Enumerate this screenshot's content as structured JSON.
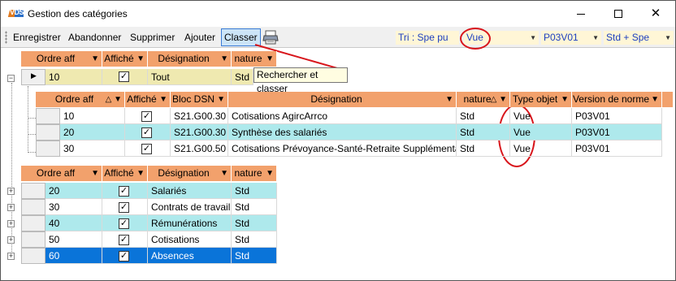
{
  "window": {
    "title": "Gestion des catégories",
    "app_icon": "vds-logo",
    "app_icon_text": "VDS",
    "minimize_icon": "minimize-icon",
    "maximize_icon": "maximize-icon",
    "close_icon": "close-icon",
    "close_glyph": "✕"
  },
  "toolbar": {
    "enregistrer": "Enregistrer",
    "abandonner": "Abandonner",
    "supprimer": "Supprimer",
    "ajouter": "Ajouter",
    "classer": "Classer",
    "print_icon": "printer-icon",
    "tri": "Tri : Spe pu",
    "vue": "Vue",
    "version": "P03V01",
    "std": "Std + Spe"
  },
  "tooltip": "Rechercher et classer",
  "top_grid": {
    "headers": [
      "Ordre aff",
      "Affiché",
      "Désignation",
      "nature"
    ],
    "row": {
      "ordre": "10",
      "affiche": true,
      "designation": "Tout",
      "nature": "Std"
    }
  },
  "child_grid": {
    "headers": [
      "Ordre aff",
      "Affiché",
      "Bloc DSN",
      "Désignation",
      "nature",
      "Type objet",
      "Version de norme"
    ],
    "rows": [
      {
        "ordre": "10",
        "affiche": true,
        "bloc": "S21.G00.30",
        "designation": "Cotisations AgircArrco",
        "nature": "Std",
        "type": "Vue",
        "version": "P03V01"
      },
      {
        "ordre": "20",
        "affiche": true,
        "bloc": "S21.G00.30",
        "designation": "Synthèse des salariés",
        "nature": "Std",
        "type": "Vue",
        "version": "P03V01"
      },
      {
        "ordre": "30",
        "affiche": true,
        "bloc": "S21.G00.50",
        "designation": "Cotisations Prévoyance-Santé-Retraite Supplémentaire",
        "nature": "Std",
        "type": "Vue",
        "version": "P03V01"
      }
    ]
  },
  "bottom_grid": {
    "headers": [
      "Ordre aff",
      "Affiché",
      "Désignation",
      "nature"
    ],
    "rows": [
      {
        "ordre": "20",
        "affiche": true,
        "designation": "Salariés",
        "nature": "Std"
      },
      {
        "ordre": "30",
        "affiche": true,
        "designation": "Contrats de travail",
        "nature": "Std"
      },
      {
        "ordre": "40",
        "affiche": true,
        "designation": "Rémunérations",
        "nature": "Std"
      },
      {
        "ordre": "50",
        "affiche": true,
        "designation": "Cotisations",
        "nature": "Std"
      },
      {
        "ordre": "60",
        "affiche": true,
        "designation": "Absences",
        "nature": "Std"
      }
    ]
  },
  "colors": {
    "header_orange": "#f2a16c",
    "row_cyan": "#aee9ec",
    "row_yellow": "#efe9b0",
    "row_selected": "#0a74d9",
    "annotation_red": "#d8151b",
    "combo_bg": "#fff6d6",
    "combo_text": "#1d3fbf"
  },
  "icons": {
    "filter": "filter-icon",
    "sort": "sort-icon",
    "expand": "expand-plus-icon",
    "collapse": "collapse-minus-icon",
    "row_pointer": "row-pointer-icon",
    "check": "checkmark-icon"
  }
}
